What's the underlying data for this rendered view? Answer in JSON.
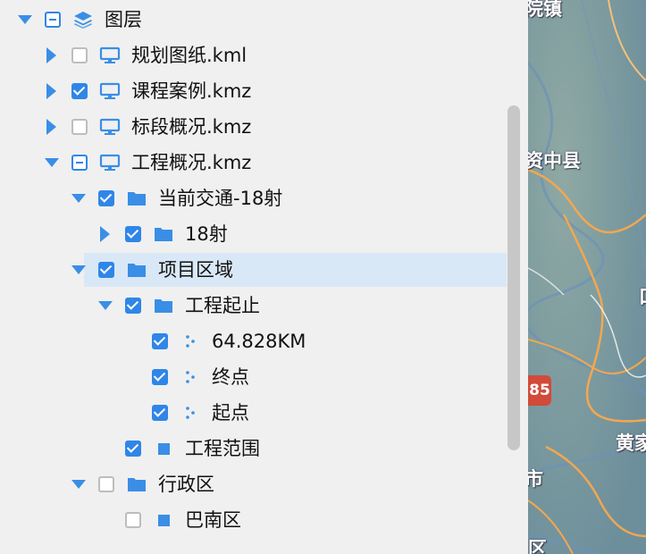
{
  "tree": {
    "rows": [
      {
        "label": "图层",
        "depth": 0,
        "expander": "expanded",
        "check": "partial",
        "icon": "layers"
      },
      {
        "label": "规划图纸.kml",
        "depth": 1,
        "expander": "collapsed",
        "check": "unchecked",
        "icon": "monitor"
      },
      {
        "label": "课程案例.kmz",
        "depth": 1,
        "expander": "collapsed",
        "check": "checked",
        "icon": "monitor"
      },
      {
        "label": "标段概况.kmz",
        "depth": 1,
        "expander": "collapsed",
        "check": "unchecked",
        "icon": "monitor"
      },
      {
        "label": "工程概况.kmz",
        "depth": 1,
        "expander": "expanded",
        "check": "partial",
        "icon": "monitor"
      },
      {
        "label": "当前交通-18射",
        "depth": 2,
        "expander": "expanded",
        "check": "checked",
        "icon": "folder"
      },
      {
        "label": "18射",
        "depth": 3,
        "expander": "collapsed",
        "check": "checked",
        "icon": "folder"
      },
      {
        "label": "项目区域",
        "depth": 2,
        "expander": "expanded",
        "check": "checked",
        "icon": "folder",
        "selected": true
      },
      {
        "label": "工程起止",
        "depth": 3,
        "expander": "expanded",
        "check": "checked",
        "icon": "folder"
      },
      {
        "label": "64.828KM",
        "depth": 4,
        "expander": "none",
        "check": "checked",
        "icon": "points"
      },
      {
        "label": "终点",
        "depth": 4,
        "expander": "none",
        "check": "checked",
        "icon": "points"
      },
      {
        "label": "起点",
        "depth": 4,
        "expander": "none",
        "check": "checked",
        "icon": "points"
      },
      {
        "label": "工程范围",
        "depth": 3,
        "expander": "none",
        "check": "checked",
        "icon": "polygon"
      },
      {
        "label": "行政区",
        "depth": 2,
        "expander": "expanded",
        "check": "unchecked",
        "icon": "folder"
      },
      {
        "label": "巴南区",
        "depth": 3,
        "expander": "none",
        "check": "unchecked",
        "icon": "polygon"
      }
    ]
  },
  "map": {
    "labels": [
      {
        "text": "院镇",
        "key": "l1"
      },
      {
        "text": "资中县",
        "key": "l2"
      },
      {
        "text": "黄家",
        "key": "l3"
      },
      {
        "text": "市",
        "key": "l4"
      },
      {
        "text": "区",
        "key": "l5"
      },
      {
        "text": "口",
        "key": "l6"
      }
    ],
    "road_badge": "85"
  },
  "colors": {
    "accent": "#2f86e8",
    "icon_blue": "#3a8ee6",
    "selection": "#d9e8f6",
    "panel_bg": "#f0f0f0"
  }
}
